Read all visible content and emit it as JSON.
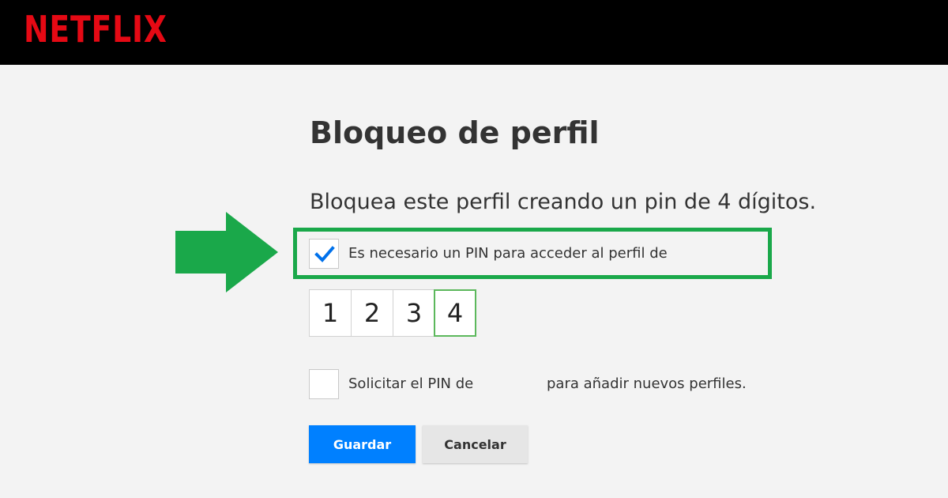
{
  "header": {
    "logo_text": "NETFLIX",
    "brand_color": "#e50914"
  },
  "main": {
    "title": "Bloqueo de perfil",
    "subtitle": "Bloquea este perfil creando un pin de 4 dígitos.",
    "require_pin": {
      "label": "Es necesario un PIN para acceder al perfil de",
      "checked": true
    },
    "pin_digits": [
      "1",
      "2",
      "3",
      "4"
    ],
    "request_pin": {
      "label_before": "Solicitar el PIN de",
      "label_after": "para añadir nuevos perfiles.",
      "checked": false
    },
    "save_label": "Guardar",
    "cancel_label": "Cancelar"
  },
  "annotation": {
    "highlight_color": "#1aa84a",
    "arrow_color": "#1aa84a"
  },
  "colors": {
    "primary_button": "#0080ff",
    "checkmark": "#0071eb"
  }
}
